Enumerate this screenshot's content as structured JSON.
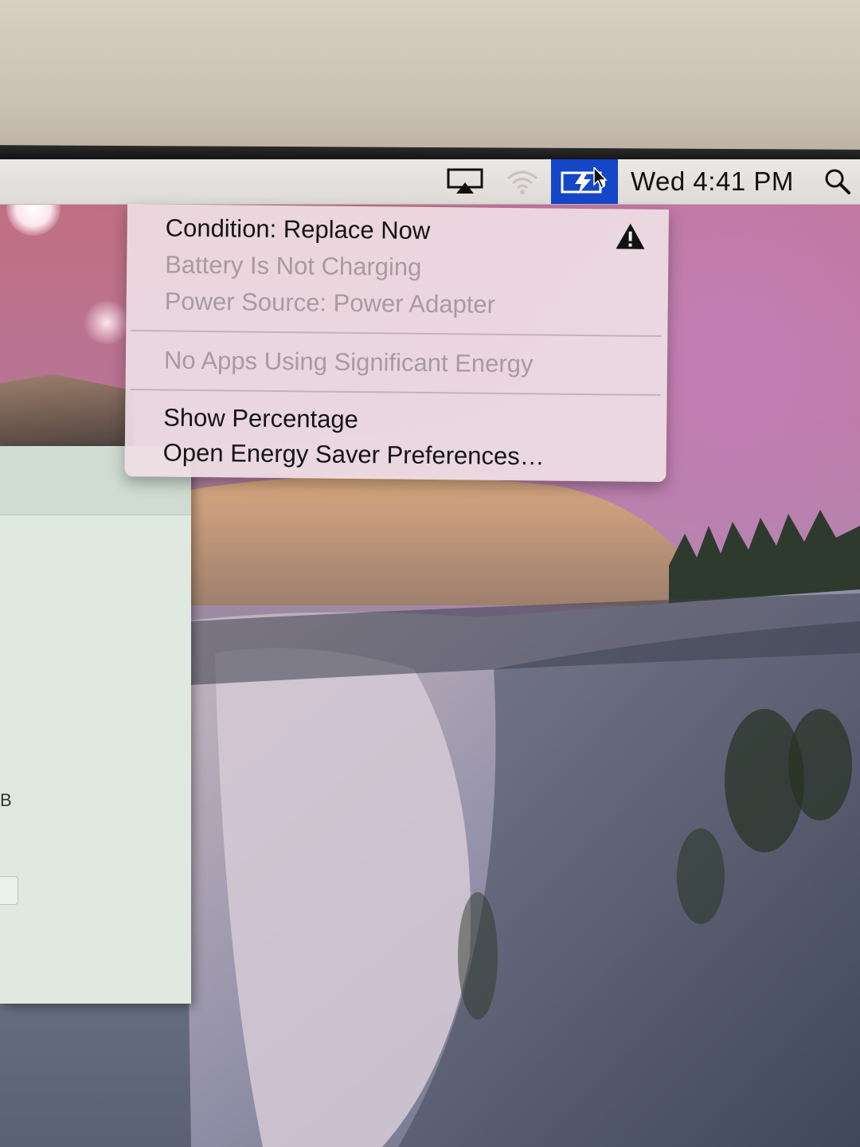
{
  "menubar": {
    "clock": "Wed 4:41 PM",
    "icons": {
      "airplay": "airplay-icon",
      "wifi": "wifi-icon",
      "battery": "battery-icon",
      "search": "search-icon"
    },
    "battery_highlight_color": "#1446c7"
  },
  "battery_menu": {
    "condition": "Condition: Replace Now",
    "status": "Battery Is Not Charging",
    "power_source": "Power Source: Power Adapter",
    "energy_apps": "No Apps Using Significant Energy",
    "show_percentage": "Show Percentage",
    "open_prefs": "Open Energy Saver Preferences…",
    "warning_icon": "warning-icon"
  },
  "background_window": {
    "fragment": "B"
  }
}
